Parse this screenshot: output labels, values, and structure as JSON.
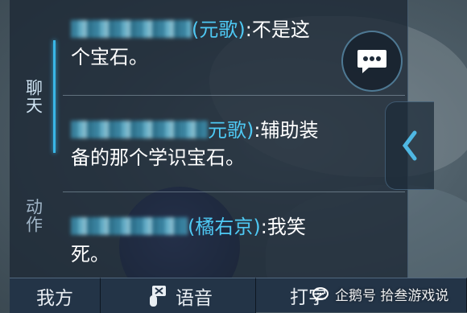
{
  "chat_tabs": [
    {
      "label": "聊天"
    },
    {
      "label": "动作"
    }
  ],
  "messages": [
    {
      "name": "(元歌)",
      "line1": ":不是这",
      "line2": "个宝石。"
    },
    {
      "name": "元歌)",
      "line1": ":辅助装",
      "line2": "备的那个学识宝石。"
    },
    {
      "name": "(橘右京)",
      "line1": ":我笑",
      "line2": "死。"
    }
  ],
  "bottom_bar": {
    "team_label": "我方",
    "voice_label": "语音",
    "type_label": "打字"
  },
  "watermark": {
    "text": "企鹅号 拾叁游戏说"
  },
  "colors": {
    "name_color": "#4ec9f4",
    "message_color": "#ffffff",
    "active_tab_indicator": "#39b6e6"
  }
}
